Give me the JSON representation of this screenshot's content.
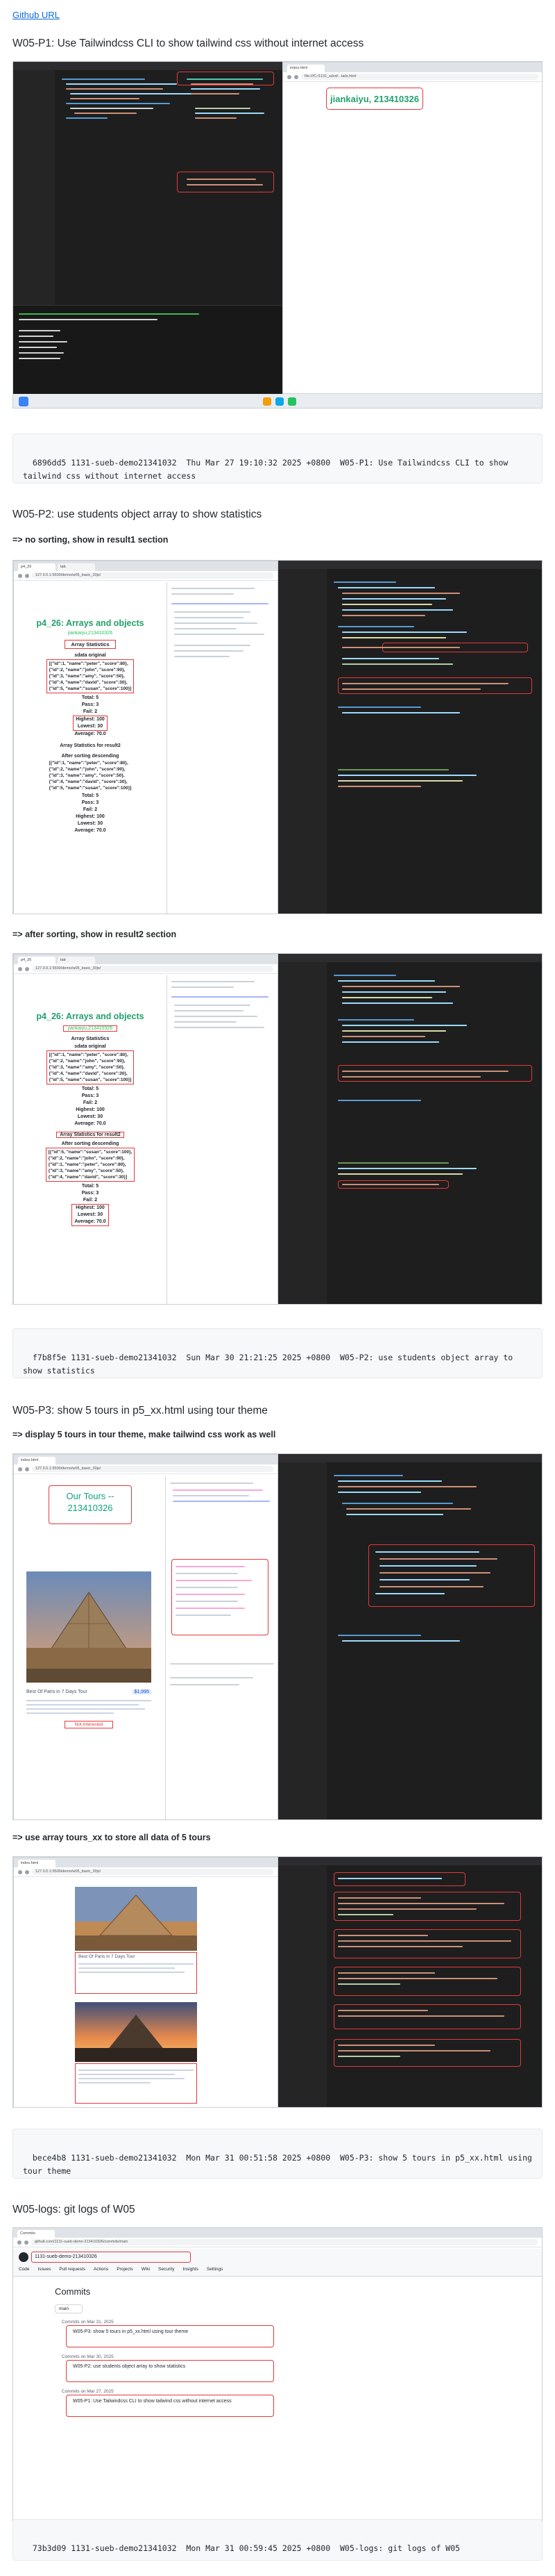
{
  "header": {
    "github_link": "Github URL"
  },
  "p1": {
    "title": "W05-P1: Use Tailwindcss CLI to show tailwind css without internet access",
    "browser_tab": "index.html",
    "browser_url": "file:///C:/1131_sdvd/...tails.html",
    "page_heading": "jiankaiyu, 213410326",
    "commit": "6896dd5 1131-sueb-demo21341032  Thu Mar 27 19:10:32 2025 +0800  W05-P1: Use Tailwindcss CLI to show tailwind css without internet access"
  },
  "p2": {
    "title": "W05-P2: use students object array to show statistics",
    "note_no_sort": "=> no sorting, show in result1 section",
    "note_after_sort": "=> after sorting, show in result2 section",
    "page": {
      "heading": "p4_26: Arrays and objects",
      "subheading": "jiankaiyu,213410326",
      "stats_title": "Array Statistics",
      "original_label": "sdata original",
      "students": [
        "[{\"id\":1, \"name\":\"peter\", \"score\":80},",
        "{\"id\":2, \"name\":\"john\", \"score\":90},",
        "{\"id\":3, \"name\":\"amy\", \"score\":50},",
        "{\"id\":4, \"name\":\"david\", \"score\":30},",
        "{\"id\":5, \"name\":\"susan\", \"score\":100}]"
      ],
      "stats": [
        "Total: 5",
        "Pass: 3",
        "Fail: 2",
        "Highest: 100",
        "Lowest: 30",
        "Average: 70.0"
      ],
      "result2_label": "Array Statistics for result2",
      "sorted_label": "After sorting descending",
      "sorted_students": [
        "[{\"id\":5, \"name\":\"susan\", \"score\":100},",
        "{\"id\":2, \"name\":\"john\", \"score\":90},",
        "{\"id\":1, \"name\":\"peter\", \"score\":80},",
        "{\"id\":3, \"name\":\"amy\", \"score\":50},",
        "{\"id\":4, \"name\":\"david\", \"score\":30}]"
      ]
    },
    "commit": "f7b8f5e 1131-sueb-demo21341032  Sun Mar 30 21:21:25 2025 +0800  W05-P2: use students object array to show statistics"
  },
  "p3": {
    "title": "W05-P3: show 5 tours in p5_xx.html using tour theme",
    "note_theme": "=> display 5 tours in tour theme, make tailwind css work as well",
    "note_array": "=> use array tours_xx to store all data of 5 tours",
    "tour_heading": "Our Tours -- 213410326",
    "tour_card_title": "Best Of Paris in 7 Days Tour",
    "tour_card_price": "$1,995",
    "tour_card_link": "Not Interested",
    "commit": "bece4b8 1131-sueb-demo21341032  Mon Mar 31 00:51:58 2025 +0800  W05-P3: show 5 tours in p5_xx.html using tour theme"
  },
  "logs": {
    "title": "W05-logs: git logs of W05",
    "repo": "1131-sueb-demo-213410326",
    "tabs": [
      "Code",
      "Issues",
      "Pull requests",
      "Actions",
      "Projects",
      "Wiki",
      "Security",
      "Insights",
      "Settings"
    ],
    "commits_heading": "Commits",
    "branch": "main",
    "groups": [
      {
        "date": "Commits on Mar 31, 2025",
        "msg": "W05-P3: show 5 tours in p5_xx.html using tour theme"
      },
      {
        "date": "Commits on Mar 30, 2025",
        "msg": "W05-P2: use students object array to show statistics"
      },
      {
        "date": "Commits on Mar 27, 2025",
        "msg": "W05-P1: Use Tailwindcss CLI to show tailwind css without internet access"
      }
    ],
    "commit": "73b3d09 1131-sueb-demo21341032  Mon Mar 31 00:59:45 2025 +0800  W05-logs: git logs of W05"
  },
  "colors": {
    "link": "#0969da",
    "highlight": "#e5383b",
    "green_title": "#22a06b",
    "ide_bg": "#1e1e1e"
  }
}
